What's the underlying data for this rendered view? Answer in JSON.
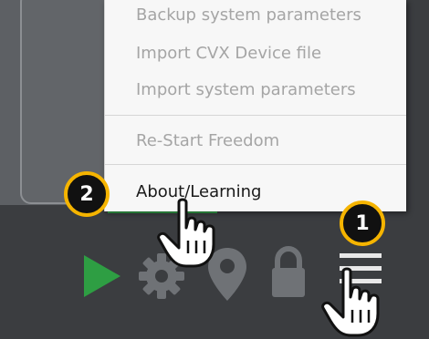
{
  "menu": {
    "items": [
      {
        "label": "Backup system parameters",
        "state": "disabled"
      },
      {
        "label": "Import CVX Device file",
        "state": "disabled"
      },
      {
        "label": "Import system parameters",
        "state": "disabled"
      },
      {
        "label": "Re-Start Freedom",
        "state": "disabled"
      },
      {
        "label": "About/Learning",
        "state": "enabled"
      }
    ]
  },
  "callouts": [
    {
      "number": "1"
    },
    {
      "number": "2"
    }
  ],
  "toolbar": {
    "icons": [
      "play-icon",
      "gear-icon",
      "location-pin-icon",
      "lock-icon",
      "hamburger-menu-icon"
    ]
  },
  "colors": {
    "play_green": "#2e9e43",
    "toolbar_icon": "#6f7276",
    "badge_ring": "#f5b400",
    "badge_fill": "#111111",
    "disabled_text": "#a5a5a5"
  }
}
